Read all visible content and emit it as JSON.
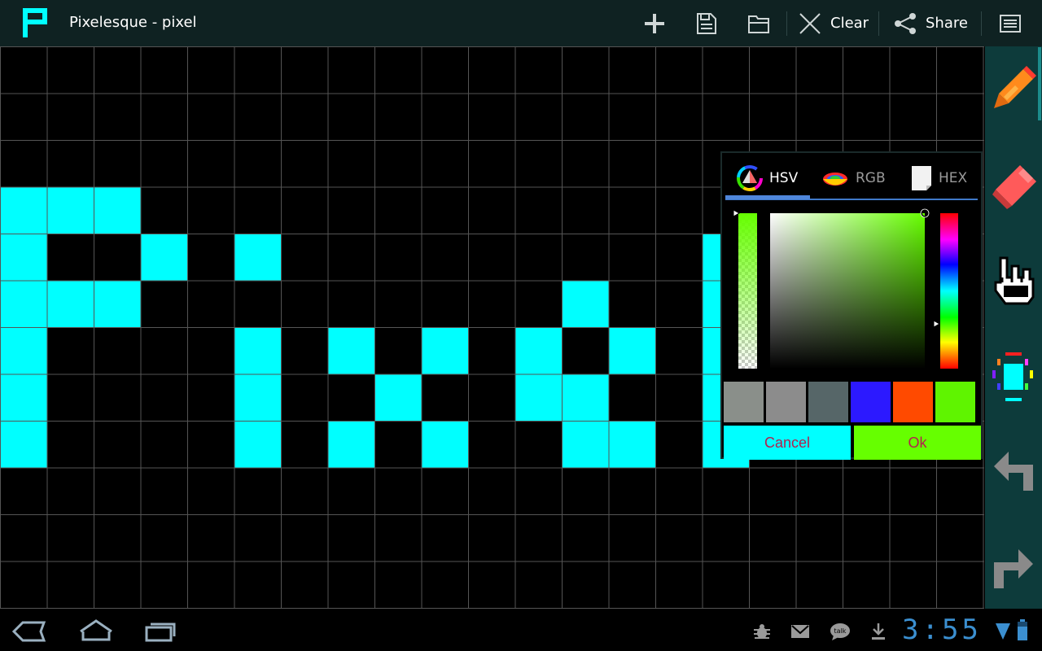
{
  "app": {
    "title": "Pixelesque - pixel",
    "logo_icon": "pixelesque-p-logo"
  },
  "actionbar": {
    "new_icon": "plus-icon",
    "save_icon": "save-document-icon",
    "open_icon": "folder-icon",
    "clear_label": "Clear",
    "clear_icon": "clear-x-icon",
    "share_label": "Share",
    "share_icon": "share-icon",
    "menu_icon": "overflow-menu-icon"
  },
  "canvas": {
    "columns": 21,
    "rows": 12,
    "background": "#000000",
    "grid_color": "#555555",
    "pixel_color": "#00ffff",
    "pixels": [
      [
        0,
        3
      ],
      [
        1,
        3
      ],
      [
        2,
        3
      ],
      [
        0,
        4
      ],
      [
        3,
        4
      ],
      [
        5,
        4
      ],
      [
        15,
        4
      ],
      [
        0,
        5
      ],
      [
        1,
        5
      ],
      [
        2,
        5
      ],
      [
        12,
        5
      ],
      [
        15,
        5
      ],
      [
        0,
        6
      ],
      [
        5,
        6
      ],
      [
        7,
        6
      ],
      [
        9,
        6
      ],
      [
        11,
        6
      ],
      [
        13,
        6
      ],
      [
        15,
        6
      ],
      [
        0,
        7
      ],
      [
        5,
        7
      ],
      [
        8,
        7
      ],
      [
        11,
        7
      ],
      [
        12,
        7
      ],
      [
        15,
        7
      ],
      [
        0,
        8
      ],
      [
        5,
        8
      ],
      [
        7,
        8
      ],
      [
        9,
        8
      ],
      [
        12,
        8
      ],
      [
        13,
        8
      ],
      [
        15,
        8
      ]
    ]
  },
  "tools": [
    {
      "name": "pencil-icon",
      "active": true
    },
    {
      "name": "eraser-icon",
      "active": false
    },
    {
      "name": "hand-pan-icon",
      "active": false
    },
    {
      "name": "color-picker-icon",
      "active": false
    },
    {
      "name": "undo-arrow-icon",
      "active": false
    },
    {
      "name": "redo-arrow-icon",
      "active": false
    }
  ],
  "color_dialog": {
    "tabs": [
      {
        "label": "HSV",
        "icon": "hsv-color-wheel-icon",
        "active": true
      },
      {
        "label": "RGB",
        "icon": "rgb-icon",
        "active": false
      },
      {
        "label": "HEX",
        "icon": "hex-table-icon",
        "active": false
      }
    ],
    "hex_icon_text": [
      "EBF6",
      "5200",
      "9080",
      "4EB"
    ],
    "current_color": "#66ff00",
    "alpha": 1.0,
    "saturation": 1.0,
    "value": 1.0,
    "hue_degrees": 95,
    "recent_colors": [
      "#8a8f8a",
      "#8c8c8c",
      "#566668",
      "#2c19ff",
      "#ff4a00",
      "#5ff400"
    ],
    "cancel_label": "Cancel",
    "ok_label": "Ok",
    "cancel_color": "#00ffff",
    "ok_color": "#66ff00",
    "button_text_color": "#b3204e"
  },
  "navbar": {
    "back_icon": "back-icon",
    "home_icon": "home-icon",
    "recents_icon": "recent-apps-icon",
    "status_icons": [
      "debug-bug-icon",
      "gmail-icon",
      "talk-icon",
      "download-icon"
    ],
    "clock": "3:55",
    "wifi_icon": "wifi-signal-icon",
    "battery_icon": "battery-icon"
  },
  "colors": {
    "actionbar_bg": "#0f2222",
    "toolrail_bg": "#0d3b3b",
    "accent_blue": "#4f86da",
    "clock_color": "#3b8fd0"
  }
}
